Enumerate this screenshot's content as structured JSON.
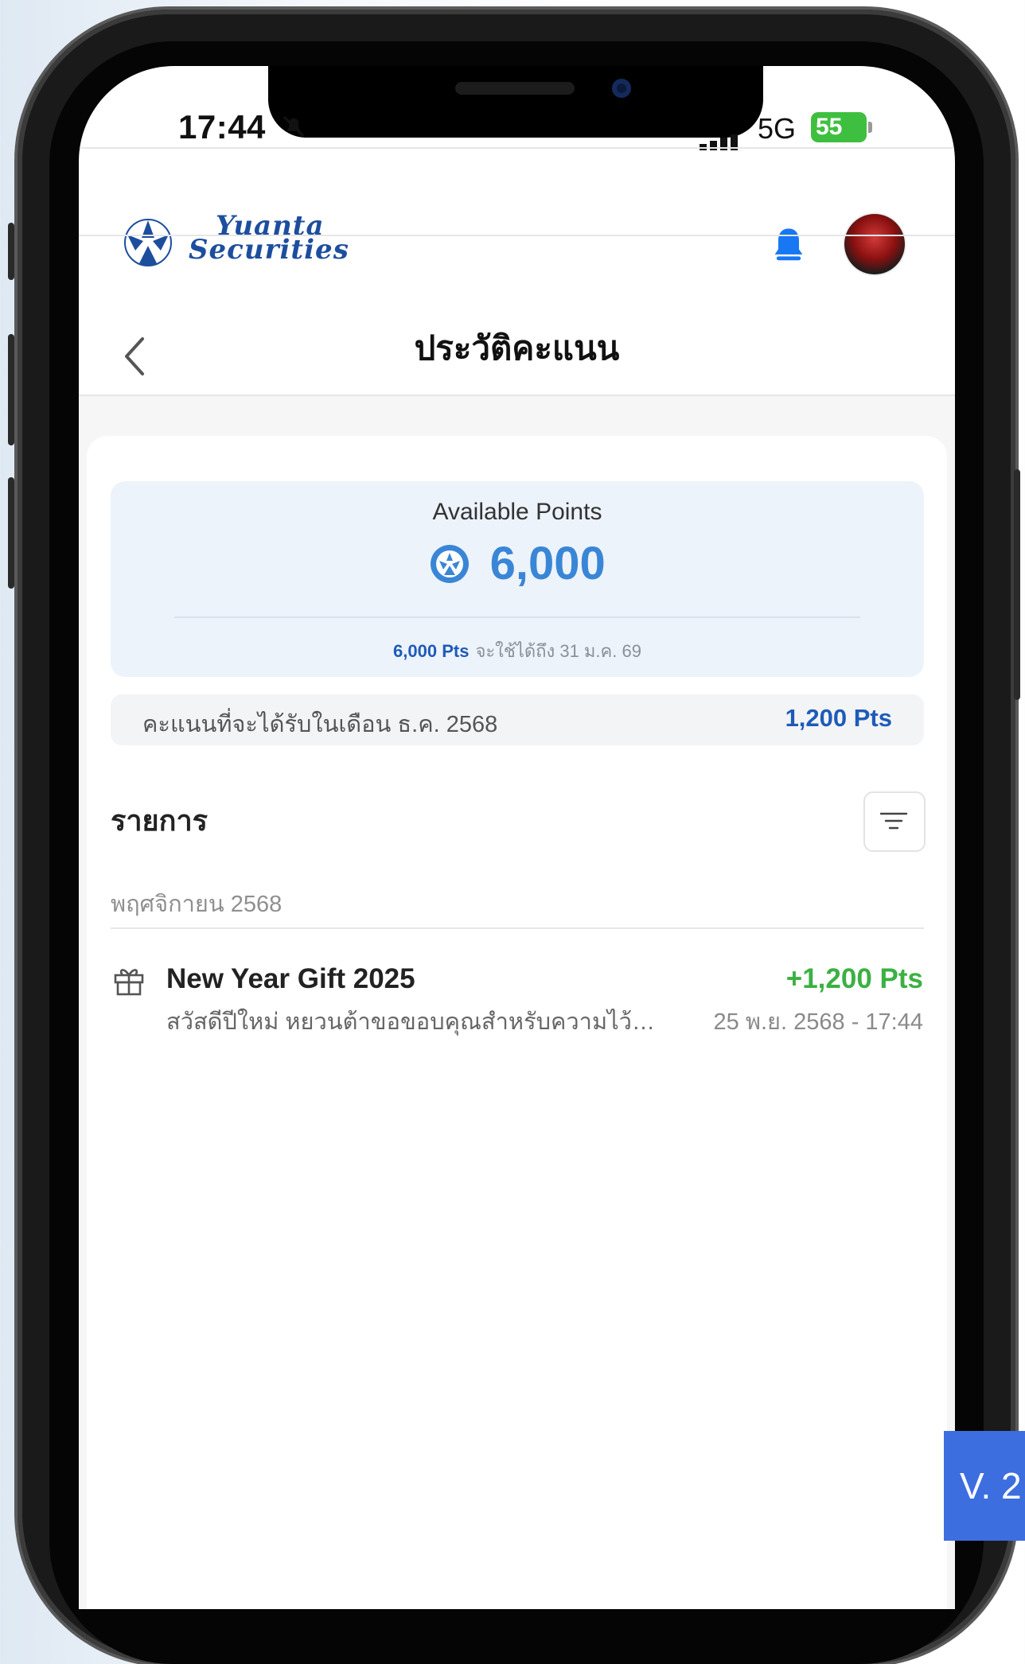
{
  "status_bar": {
    "time": "17:44",
    "network": "5G",
    "battery": "55"
  },
  "header": {
    "brand_line1": "Yuanta",
    "brand_line2": "Securities"
  },
  "nav": {
    "title": "ประวัติคะแนน"
  },
  "summary": {
    "label": "Available Points",
    "points": "6,000",
    "expiry_points": "6,000 Pts",
    "expiry_text": "จะใช้ได้ถึง 31 ม.ค. 69",
    "month_label": "คะแนนที่จะได้รับในเดือน ธ.ค. 2568",
    "month_points": "1,200 Pts"
  },
  "transactions": {
    "section_title": "รายการ",
    "groups": [
      {
        "date": "พฤศจิกายน 2568",
        "items": [
          {
            "title": "New Year Gift 2025",
            "amount": "+1,200 Pts",
            "description": "สวัสดีปีใหม่ หยวนต้าขอขอบคุณสำหรับความไว้วางใจ...",
            "datetime": "25 พ.ย. 2568 - 17:44",
            "icon": "gift-icon"
          }
        ]
      }
    ]
  },
  "version": "V. 2",
  "colors": {
    "accent_blue": "#1e5bb8",
    "points_blue": "#3a86d6",
    "positive_green": "#3cb043",
    "bell_blue": "#1877f2"
  }
}
